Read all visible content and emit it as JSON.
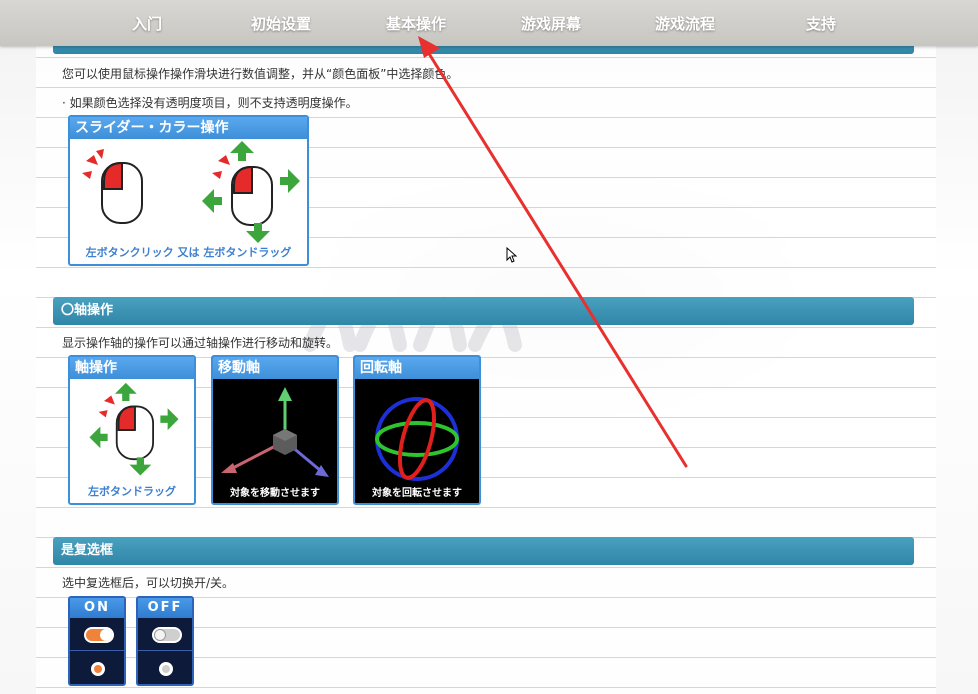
{
  "nav": {
    "items": [
      "入门",
      "初始设置",
      "基本操作",
      "游戏屏幕",
      "游戏流程",
      "支持"
    ]
  },
  "intro": {
    "line1": "您可以使用鼠标操作操作滑块进行数值调整，并从“颜色面板”中选择颜色。",
    "line2": "· 如果颜色选择没有透明度项目，则不支持透明度操作。"
  },
  "slider_card": {
    "title": "スライダー・カラー操作",
    "caption": "左ボタンクリック 又は 左ボタンドラッグ"
  },
  "axis_section": {
    "title": "〇轴操作",
    "desc": "显示操作轴的操作可以通过轴操作进行移动和旋转。",
    "cards": [
      {
        "title": "軸操作",
        "caption": "左ボタンドラッグ"
      },
      {
        "title": "移動軸",
        "caption": "対象を移動させます"
      },
      {
        "title": "回転軸",
        "caption": "対象を回転させます"
      }
    ]
  },
  "checkbox_section": {
    "title": "是复选框",
    "desc": "选中复选框后，可以切换开/关。",
    "on_label": "ON",
    "off_label": "OFF"
  },
  "colors": {
    "accent": "#2f86a7",
    "card_border": "#3d8fd9",
    "toggle_on": "#f0823a",
    "toggle_off": "#cfcfcf",
    "arrow": "#e8302e"
  }
}
